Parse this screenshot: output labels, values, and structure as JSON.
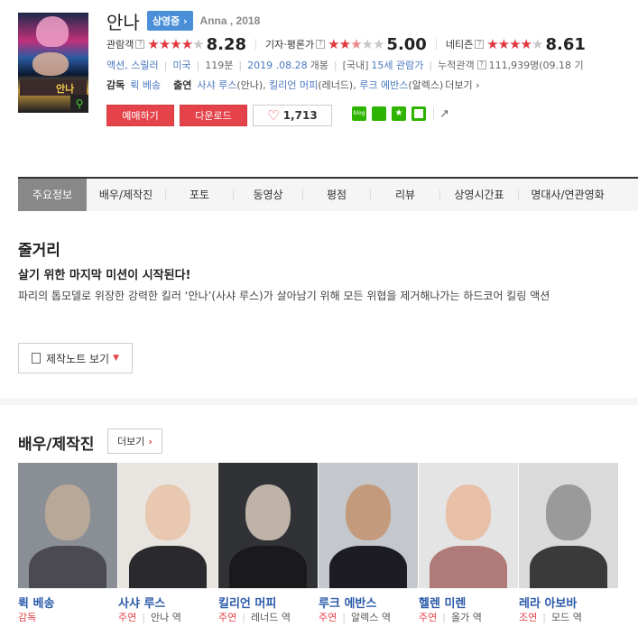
{
  "movie": {
    "title": "안나",
    "status_badge": "상영중 ›",
    "original_title": "Anna , 2018",
    "poster_text": "안나"
  },
  "ratings": [
    {
      "label": "관람객",
      "filled_stars": 4.5,
      "score": "8.28"
    },
    {
      "label": "기자·평론가",
      "filled_stars": 2.5,
      "score": "5.00"
    },
    {
      "label": "네티즌",
      "filled_stars": 4.5,
      "score": "8.61"
    }
  ],
  "meta": {
    "genre": "액션, 스릴러",
    "country": "미국",
    "runtime": "119분",
    "release_date": "2019 .08.28",
    "release_suffix": "개봉",
    "rating_prefix": "[국내]",
    "rating": "15세 관람가",
    "audience_label": "누적관객",
    "audience": "111,939명",
    "audience_date": "(09.18 기"
  },
  "credits": {
    "director_label": "감독",
    "director": "뤽 베송",
    "cast_label": "출연",
    "cast": [
      {
        "name": "사샤 루스",
        "role": "(안나)"
      },
      {
        "name": "킬리언 머피",
        "role": "(레너드)"
      },
      {
        "name": "루크 에반스",
        "role": "(알렉스)"
      }
    ],
    "more": "더보기 ›"
  },
  "buttons": {
    "reserve": "예매하기",
    "download": "다운로드",
    "likes": "1,713"
  },
  "share": {
    "blog": "blog",
    "share_icon": "↗"
  },
  "tabs": [
    {
      "label": "주요정보",
      "active": true
    },
    {
      "label": "배우/제작진",
      "active": false
    },
    {
      "label": "포토",
      "active": false
    },
    {
      "label": "동영상",
      "active": false
    },
    {
      "label": "평점",
      "active": false
    },
    {
      "label": "리뷰",
      "active": false
    },
    {
      "label": "상영시간표",
      "active": false
    },
    {
      "label": "명대사/연관영화",
      "active": false
    }
  ],
  "synopsis": {
    "heading": "줄거리",
    "tagline": "살기 위한 마지막 미션이 시작된다!",
    "text": "파리의 톱모델로 위장한 강력한 킬러 ‘안나’(사샤 루스)가 살아남기 위해 모든 위협을 제거해나가는 하드코어 킬링 액션",
    "note_button": "제작노트 보기"
  },
  "cast_section": {
    "heading": "배우/제작진",
    "more": "더보기",
    "people": [
      {
        "name": "뤽 베송",
        "type": "감독",
        "role": ""
      },
      {
        "name": "사샤 루스",
        "type": "주연",
        "role": "안나 역"
      },
      {
        "name": "킬리언 머피",
        "type": "주연",
        "role": "레너드 역"
      },
      {
        "name": "루크 에반스",
        "type": "주연",
        "role": "알렉스 역"
      },
      {
        "name": "헬렌 미렌",
        "type": "주연",
        "role": "올가 역"
      },
      {
        "name": "레라 아보바",
        "type": "조연",
        "role": "모드 역"
      }
    ]
  },
  "colors": {
    "accent_red": "#e5434a",
    "link_blue": "#4a78c0",
    "badge_blue": "#4a8fd8",
    "share_green": "#2db400"
  }
}
